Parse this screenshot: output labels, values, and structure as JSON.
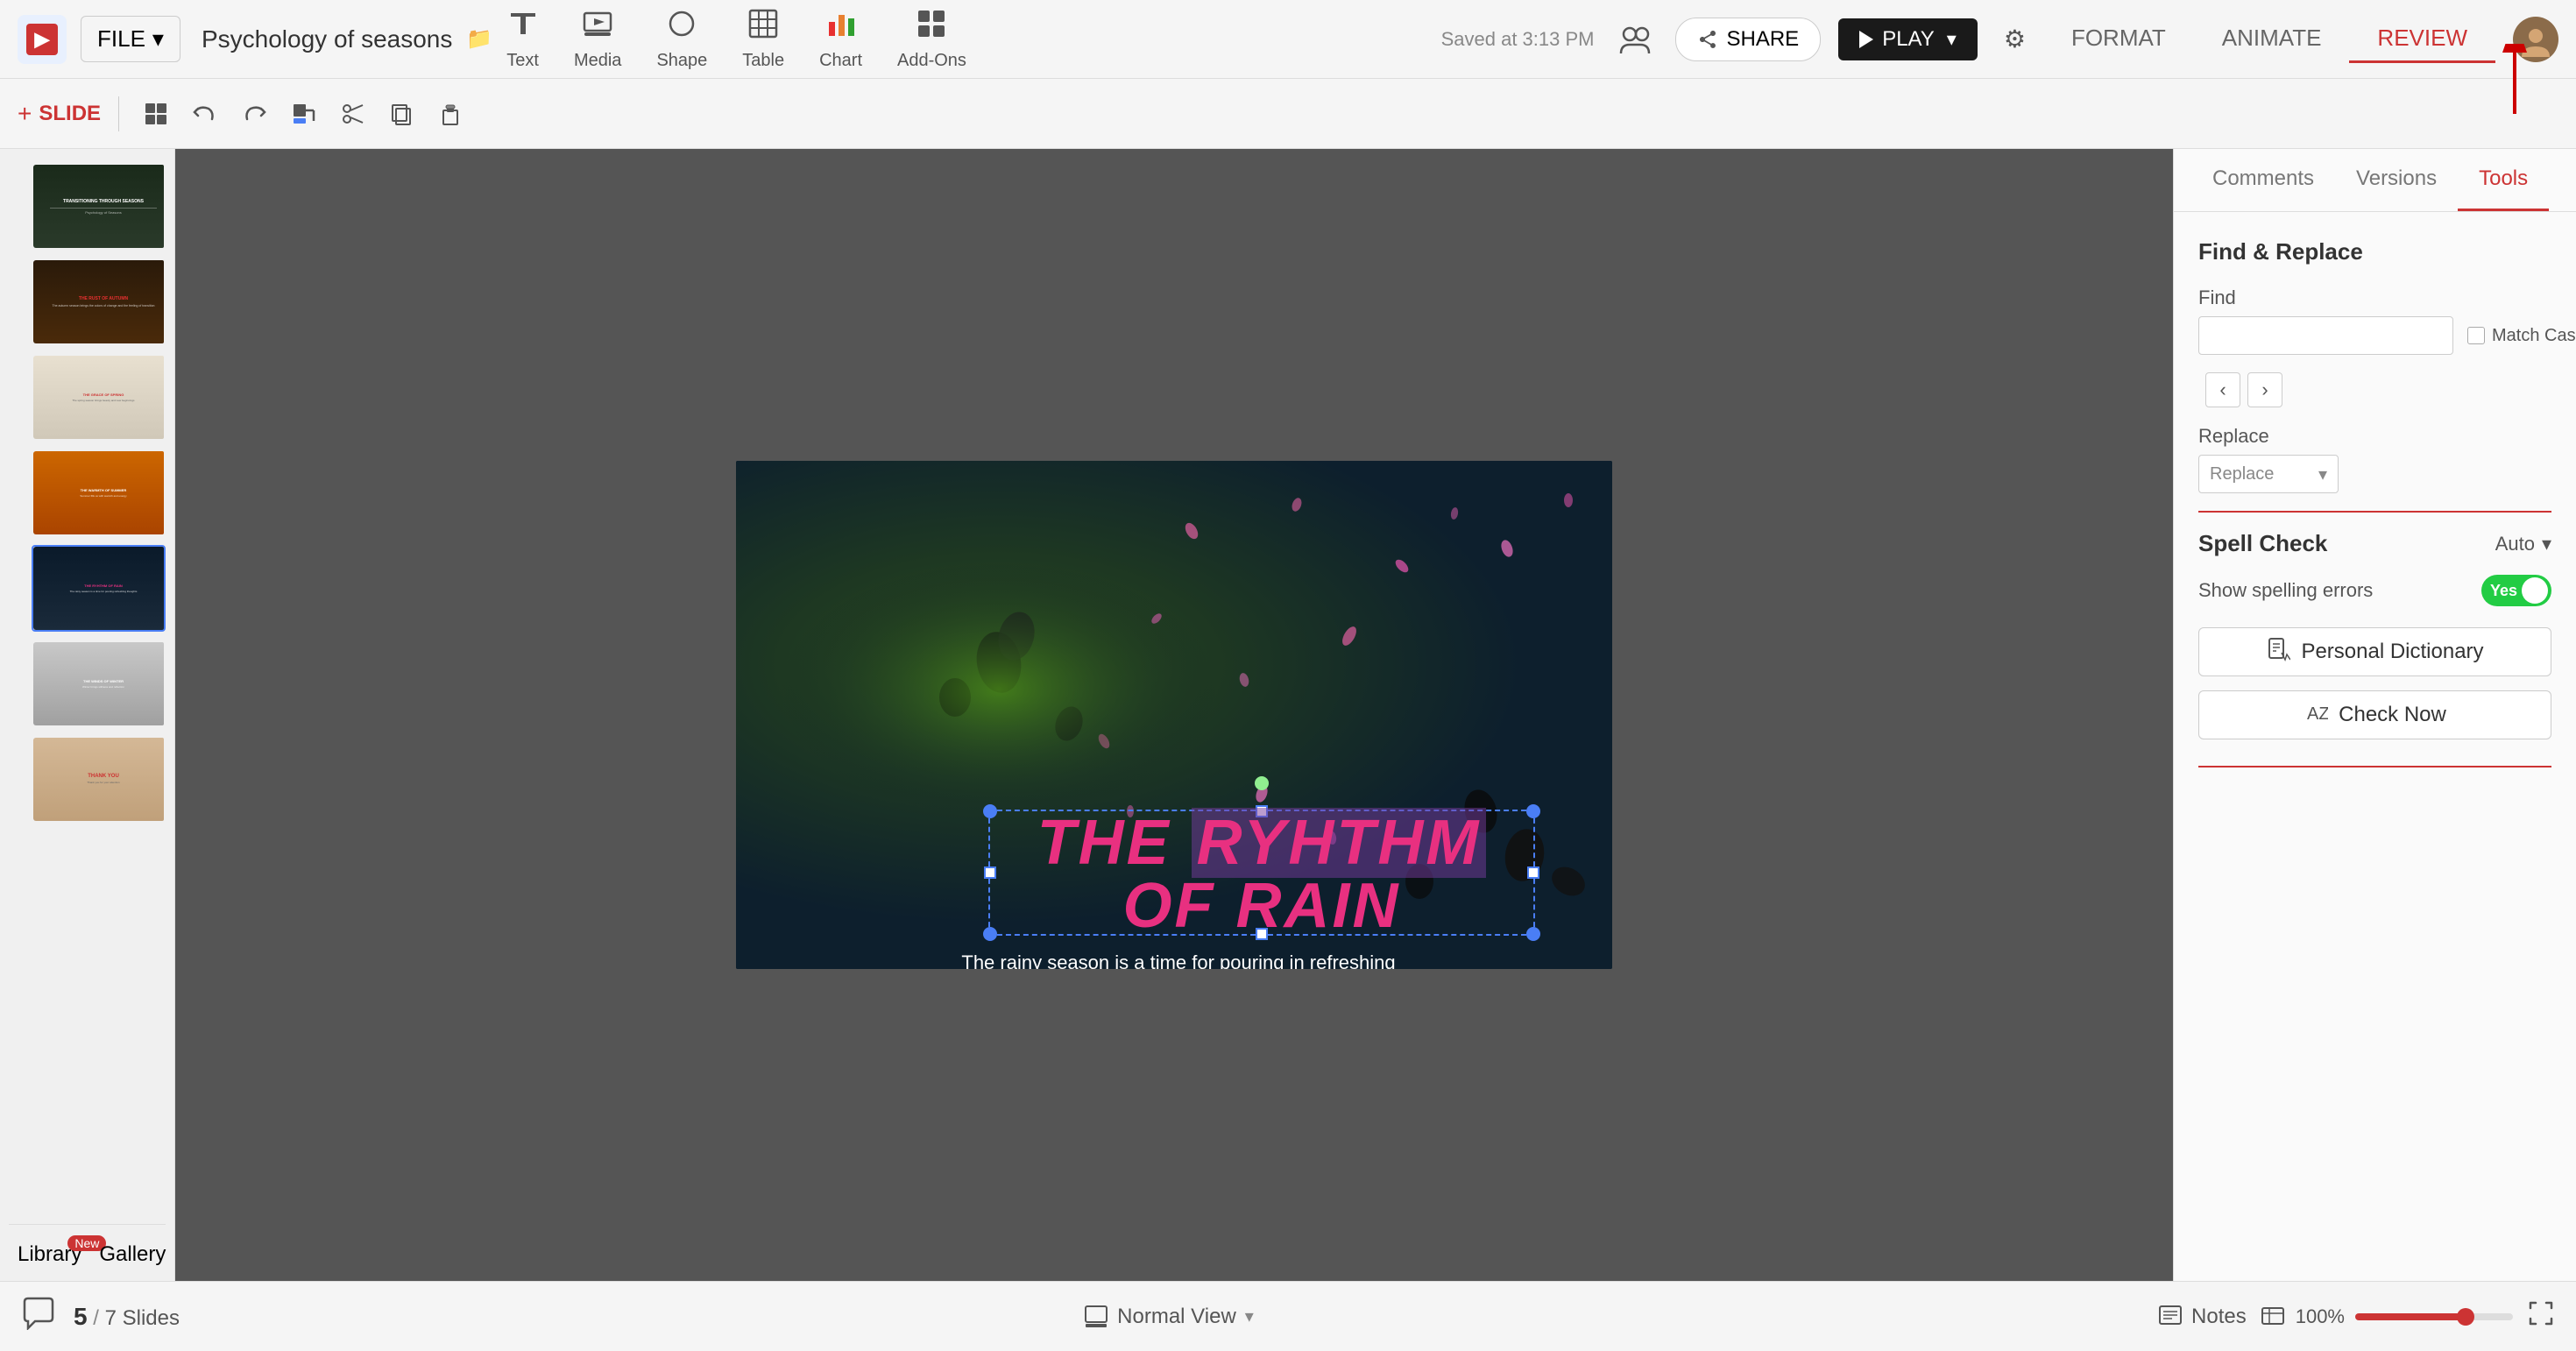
{
  "app": {
    "logo_letter": "▶",
    "file_label": "FILE",
    "file_chevron": "▾",
    "presentation_title": "Psychology of seasons",
    "title_icon": "📁"
  },
  "toolbar": {
    "items": [
      {
        "id": "text",
        "icon": "⊞",
        "label": "Text"
      },
      {
        "id": "media",
        "icon": "🎬",
        "label": "Media"
      },
      {
        "id": "shape",
        "icon": "◯",
        "label": "Shape"
      },
      {
        "id": "table",
        "icon": "⊞",
        "label": "Table"
      },
      {
        "id": "chart",
        "icon": "📊",
        "label": "Chart"
      },
      {
        "id": "addons",
        "icon": "🧩",
        "label": "Add-Ons"
      }
    ]
  },
  "topright": {
    "saved_text": "Saved at 3:13 PM",
    "share_label": "SHARE",
    "play_label": "PLAY"
  },
  "format_tabs": [
    "FORMAT",
    "ANIMATE",
    "REVIEW"
  ],
  "active_format_tab": "REVIEW",
  "slide_toolbar": {
    "slide_label": "+ SLIDE",
    "undo": "↩",
    "redo": "↪"
  },
  "review_tabs": [
    "Comments",
    "Versions",
    "Tools"
  ],
  "active_review_tab": "Tools",
  "find_replace": {
    "section_title": "Find & Replace",
    "find_label": "Find",
    "match_case_label": "Match Case",
    "replace_label": "Replace",
    "replace_placeholder": "Replace"
  },
  "spell_check": {
    "section_title": "Spell Check",
    "auto_label": "Auto",
    "show_errors_label": "Show spelling errors",
    "toggle_yes": "Yes",
    "personal_dict_label": "Personal Dictionary",
    "check_now_label": "Check Now"
  },
  "slides": [
    {
      "num": 1,
      "title": "TRANSITIONING THROUGH SEASONS",
      "bg": "dark-green",
      "thumb_text": "TRANSITIONING THROUGH SEASONS"
    },
    {
      "num": 2,
      "title": "THE RUST OF AUTUMN",
      "bg": "dark-orange",
      "thumb_text": "THE RUST OF AUTUMN"
    },
    {
      "num": 3,
      "title": "THE GRACE OF SPRING",
      "bg": "light-beige",
      "thumb_text": "THE GRACE OF SPRING"
    },
    {
      "num": 4,
      "title": "THE WARMTH OF SUMMER",
      "bg": "orange",
      "thumb_text": "THE WARMTH OF SUMMER"
    },
    {
      "num": 5,
      "title": "THE RYHTHM OF RAIN",
      "bg": "dark-blue",
      "thumb_text": "THE RYHTHM OF RAIN",
      "active": true
    },
    {
      "num": 6,
      "title": "THE WINDS OF WINTER",
      "bg": "gray",
      "thumb_text": "THE WINDS OF WINTER"
    },
    {
      "num": 7,
      "title": "THANK YOU",
      "bg": "tan",
      "thumb_text": "THANK YOU"
    }
  ],
  "current_slide": {
    "main_title_before": "THE ",
    "main_title_highlight": "RYHTHM",
    "main_title_after": " OF RAIN",
    "subtitle": "The rainy season is a time for pouring in refreshing\nthoughts and for finding inner peace of mind."
  },
  "bottom": {
    "slide_current": "5",
    "slide_total": "7 Slides",
    "view_label": "Normal View",
    "notes_label": "Notes",
    "zoom_level": "100%",
    "library_label": "Library",
    "library_new": "New",
    "gallery_label": "Gallery"
  }
}
